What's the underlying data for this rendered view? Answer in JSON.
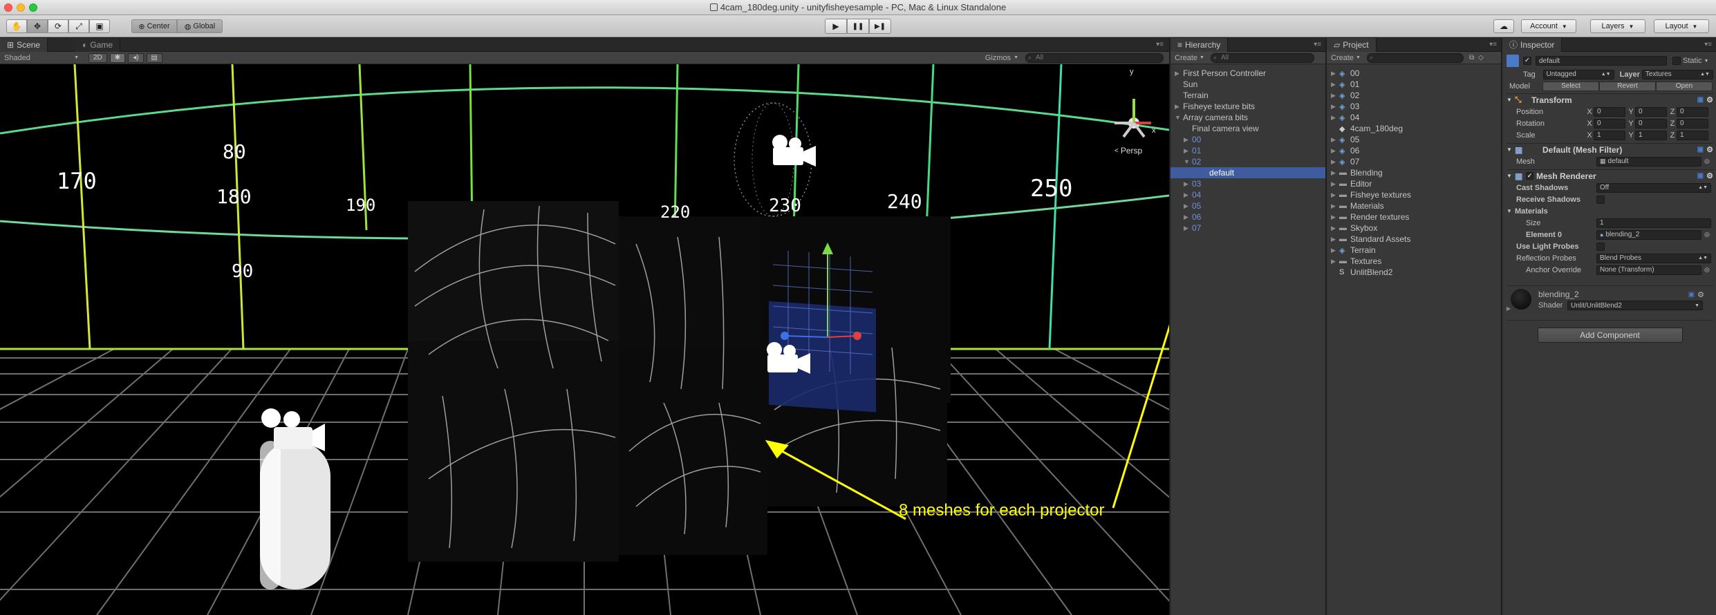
{
  "window": {
    "title": "4cam_180deg.unity - unityfisheyesample - PC, Mac & Linux Standalone",
    "traffic_close": "#fc5f57",
    "traffic_min": "#fdbc2e",
    "traffic_max": "#28c940"
  },
  "toolbar": {
    "tools": [
      "hand-tool",
      "move-tool",
      "rotate-tool",
      "scale-tool",
      "rect-tool"
    ],
    "pivot_label": "Center",
    "space_label": "Global",
    "play_icon": "▶",
    "pause_icon": "❚❚",
    "step_icon": "▶❚",
    "cloud_icon": "☁",
    "account_label": "Account",
    "layers_label": "Layers",
    "layout_label": "Layout"
  },
  "scene_panel": {
    "tabs": [
      "Scene",
      "Game"
    ],
    "shading_mode": "Shaded",
    "mode_2d": "2D",
    "gizmos_label": "Gizmos",
    "search_placeholder": "All",
    "persp_label": "Persp",
    "gizmo_axis_y": "y",
    "gizmo_axis_x": "x",
    "sky_labels": [
      "170",
      "180",
      "190",
      "220",
      "230",
      "240",
      "250",
      "80",
      "90"
    ],
    "annotation": "8 meshes for each projector"
  },
  "hierarchy": {
    "tab": "Hierarchy",
    "create_label": "Create",
    "search_placeholder": "All",
    "items": [
      {
        "label": "First Person Controller",
        "indent": 0,
        "arrow": "▶",
        "style": "normal"
      },
      {
        "label": "Sun",
        "indent": 0,
        "arrow": "",
        "style": "normal"
      },
      {
        "label": "Terrain",
        "indent": 0,
        "arrow": "",
        "style": "normal"
      },
      {
        "label": "Fisheye texture bits",
        "indent": 0,
        "arrow": "▶",
        "style": "normal"
      },
      {
        "label": "Array camera bits",
        "indent": 0,
        "arrow": "▼",
        "style": "normal"
      },
      {
        "label": "Final camera view",
        "indent": 1,
        "arrow": "",
        "style": "normal"
      },
      {
        "label": "00",
        "indent": 1,
        "arrow": "▶",
        "style": "blue"
      },
      {
        "label": "01",
        "indent": 1,
        "arrow": "▶",
        "style": "blue"
      },
      {
        "label": "02",
        "indent": 1,
        "arrow": "▼",
        "style": "blue"
      },
      {
        "label": "default",
        "indent": 2,
        "arrow": "",
        "style": "selected"
      },
      {
        "label": "03",
        "indent": 1,
        "arrow": "▶",
        "style": "blue"
      },
      {
        "label": "04",
        "indent": 1,
        "arrow": "▶",
        "style": "blue"
      },
      {
        "label": "05",
        "indent": 1,
        "arrow": "▶",
        "style": "blue"
      },
      {
        "label": "06",
        "indent": 1,
        "arrow": "▶",
        "style": "blue"
      },
      {
        "label": "07",
        "indent": 1,
        "arrow": "▶",
        "style": "blue"
      }
    ]
  },
  "project": {
    "tab": "Project",
    "create_label": "Create",
    "items": [
      {
        "label": "00",
        "icon": "prefab-icon",
        "arrow": "▶"
      },
      {
        "label": "01",
        "icon": "prefab-icon",
        "arrow": "▶"
      },
      {
        "label": "02",
        "icon": "prefab-icon",
        "arrow": "▶"
      },
      {
        "label": "03",
        "icon": "prefab-icon",
        "arrow": "▶"
      },
      {
        "label": "04",
        "icon": "prefab-icon",
        "arrow": "▶"
      },
      {
        "label": "4cam_180deg",
        "icon": "unity-scene-icon",
        "arrow": ""
      },
      {
        "label": "05",
        "icon": "prefab-icon",
        "arrow": "▶"
      },
      {
        "label": "06",
        "icon": "prefab-icon",
        "arrow": "▶"
      },
      {
        "label": "07",
        "icon": "prefab-icon",
        "arrow": "▶"
      },
      {
        "label": "Blending",
        "icon": "folder-icon",
        "arrow": "▶"
      },
      {
        "label": "Editor",
        "icon": "folder-icon",
        "arrow": "▶"
      },
      {
        "label": "Fisheye textures",
        "icon": "folder-icon",
        "arrow": "▶"
      },
      {
        "label": "Materials",
        "icon": "folder-icon",
        "arrow": "▶"
      },
      {
        "label": "Render textures",
        "icon": "folder-icon",
        "arrow": "▶"
      },
      {
        "label": "Skybox",
        "icon": "folder-icon",
        "arrow": "▶"
      },
      {
        "label": "Standard Assets",
        "icon": "folder-icon",
        "arrow": "▶"
      },
      {
        "label": "Terrain",
        "icon": "prefab-icon",
        "arrow": "▶"
      },
      {
        "label": "Textures",
        "icon": "folder-icon",
        "arrow": "▶"
      },
      {
        "label": "UnlitBlend2",
        "icon": "shader-icon",
        "arrow": ""
      }
    ]
  },
  "inspector": {
    "tab": "Inspector",
    "object_name": "default",
    "static_label": "Static",
    "tag_label": "Tag",
    "tag_value": "Untagged",
    "layer_label": "Layer",
    "layer_value": "Textures",
    "model_label": "Model",
    "model_select": "Select",
    "model_revert": "Revert",
    "model_open": "Open",
    "transform": {
      "title": "Transform",
      "rows": [
        {
          "label": "Position",
          "x": "0",
          "y": "0",
          "z": "0"
        },
        {
          "label": "Rotation",
          "x": "0",
          "y": "0",
          "z": "0"
        },
        {
          "label": "Scale",
          "x": "1",
          "y": "1",
          "z": "1"
        }
      ],
      "axis_x": "X",
      "axis_y": "Y",
      "axis_z": "Z"
    },
    "mesh_filter": {
      "title": "Default (Mesh Filter)",
      "mesh_label": "Mesh",
      "mesh_value": "default"
    },
    "mesh_renderer": {
      "title": "Mesh Renderer",
      "cast_shadows_label": "Cast Shadows",
      "cast_shadows_value": "Off",
      "receive_shadows_label": "Receive Shadows",
      "materials_label": "Materials",
      "size_label": "Size",
      "size_value": "1",
      "element0_label": "Element 0",
      "element0_value": "blending_2",
      "light_probes_label": "Use Light Probes",
      "reflection_probes_label": "Reflection Probes",
      "reflection_probes_value": "Blend Probes",
      "anchor_override_label": "Anchor Override",
      "anchor_override_value": "None (Transform)"
    },
    "material": {
      "name": "blending_2",
      "shader_label": "Shader",
      "shader_value": "Unlit/UnlitBlend2"
    },
    "add_component": "Add Component"
  }
}
